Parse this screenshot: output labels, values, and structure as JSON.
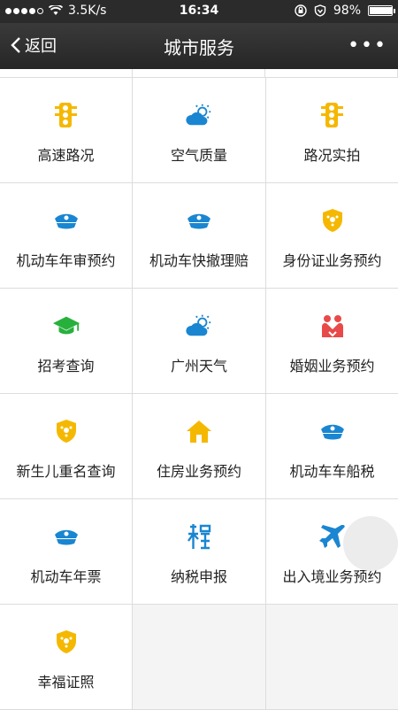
{
  "status": {
    "speed": "3.5K/s",
    "time": "16:34",
    "battery": "98%",
    "battery_level": 0.98
  },
  "nav": {
    "back_label": "返回",
    "title": "城市服务",
    "more": "•••"
  },
  "services": [
    {
      "label": "高速路况",
      "icon": "traffic-light-icon",
      "color": "#f5b800"
    },
    {
      "label": "空气质量",
      "icon": "cloud-sun-icon",
      "color": "#1a86d1"
    },
    {
      "label": "路况实拍",
      "icon": "traffic-light-icon",
      "color": "#f5b800"
    },
    {
      "label": "机动车年审预约",
      "icon": "police-cap-icon",
      "color": "#1a86d1"
    },
    {
      "label": "机动车快撤理赔",
      "icon": "police-cap-icon",
      "color": "#1a86d1"
    },
    {
      "label": "身份证业务预约",
      "icon": "police-badge-icon",
      "color": "#f5b800"
    },
    {
      "label": "招考查询",
      "icon": "graduation-cap-icon",
      "color": "#27b13c"
    },
    {
      "label": "广州天气",
      "icon": "cloud-sun-icon",
      "color": "#1a86d1"
    },
    {
      "label": "婚姻业务预约",
      "icon": "marriage-icon",
      "color": "#e84a4a"
    },
    {
      "label": "新生儿重名查询",
      "icon": "police-badge-icon",
      "color": "#f5b800"
    },
    {
      "label": "住房业务预约",
      "icon": "house-icon",
      "color": "#f5b800"
    },
    {
      "label": "机动车车船税",
      "icon": "police-cap-icon",
      "color": "#1a86d1"
    },
    {
      "label": "机动车年票",
      "icon": "police-cap-icon",
      "color": "#1a86d1"
    },
    {
      "label": "纳税申报",
      "icon": "tax-icon",
      "color": "#1a86d1"
    },
    {
      "label": "出入境业务预约",
      "icon": "airplane-icon",
      "color": "#1a86d1"
    },
    {
      "label": "幸福证照",
      "icon": "police-badge-icon",
      "color": "#f5b800"
    }
  ]
}
